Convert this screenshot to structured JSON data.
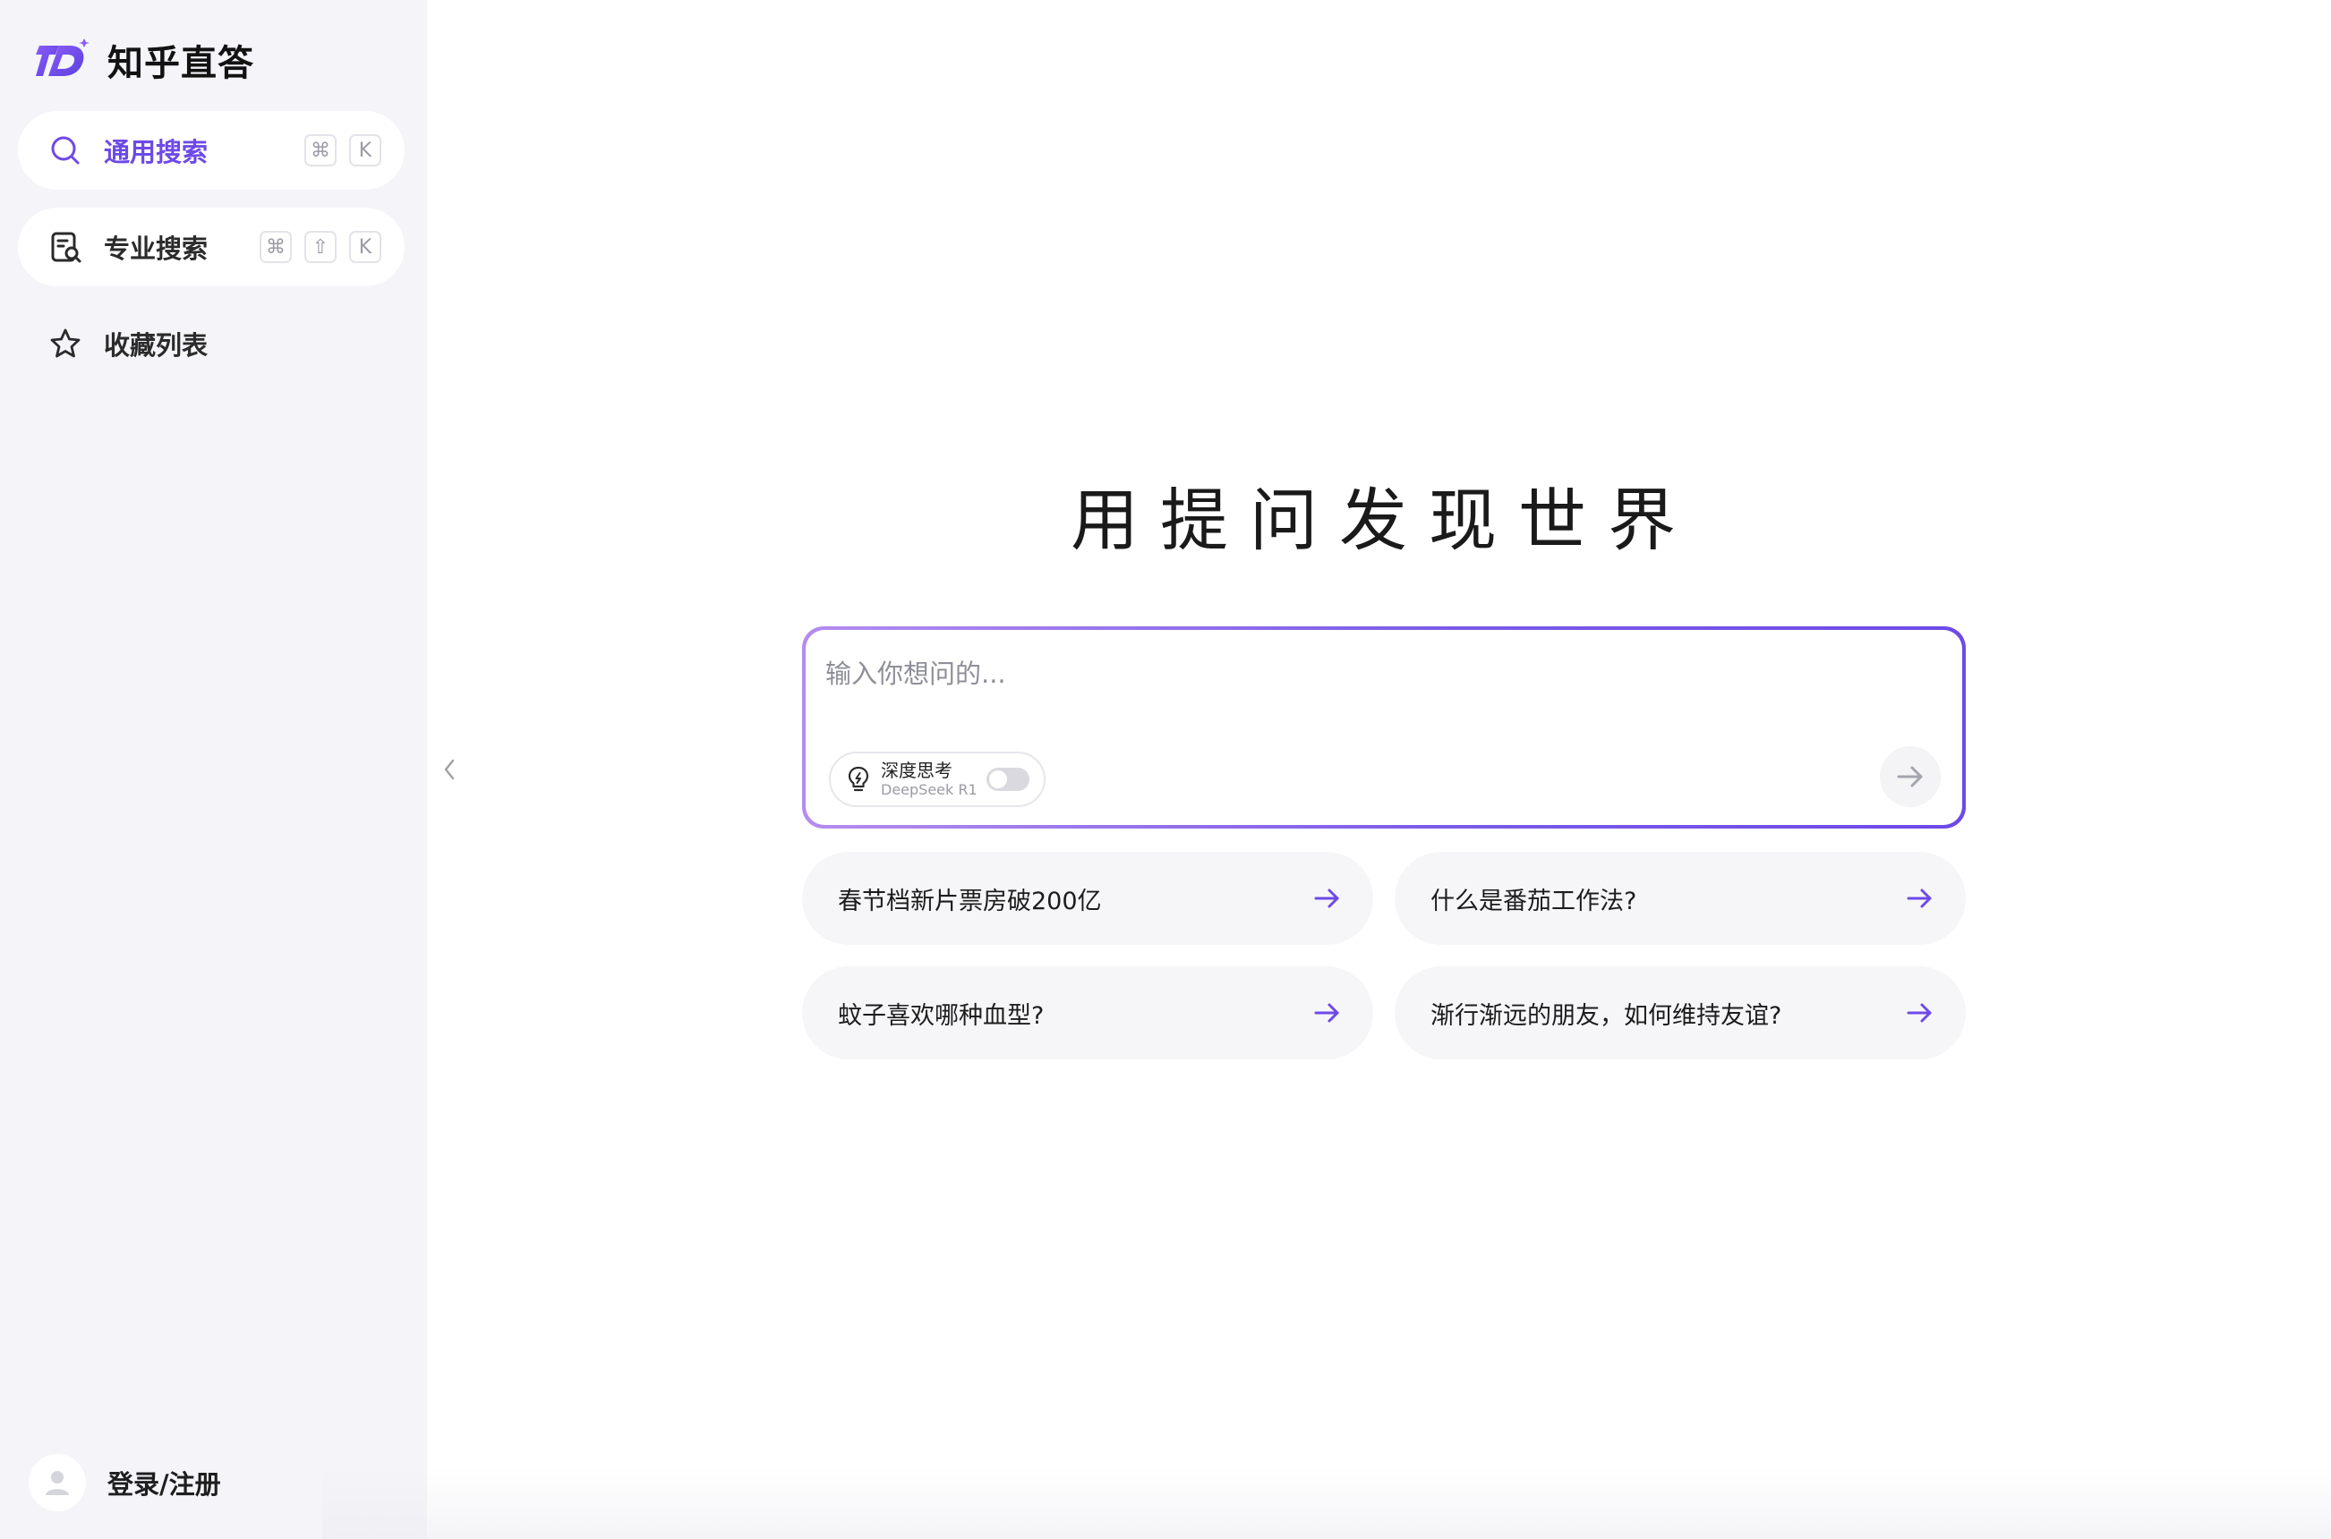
{
  "brand": {
    "name": "知乎直答",
    "logo_icon": "zhida-logo-icon",
    "accent": "#6d4ae8"
  },
  "sidebar": {
    "items": [
      {
        "label": "通用搜索",
        "icon": "search-icon",
        "shortcut": [
          "⌘",
          "K"
        ],
        "active": true
      },
      {
        "label": "专业搜索",
        "icon": "doc-search-icon",
        "shortcut": [
          "⌘",
          "⇧",
          "K"
        ],
        "active": false
      },
      {
        "label": "收藏列表",
        "icon": "star-icon",
        "active": false
      }
    ],
    "user": {
      "label": "登录/注册",
      "icon": "user-avatar-icon"
    }
  },
  "main": {
    "title": "用提问发现世界",
    "composer": {
      "placeholder": "输入你想问的...",
      "deep_think": {
        "label": "深度思考",
        "sublabel": "DeepSeek R1",
        "enabled": false
      },
      "send_icon": "arrow-right-icon"
    },
    "suggestions": [
      {
        "text": "春节档新片票房破200亿"
      },
      {
        "text": "什么是番茄工作法?"
      },
      {
        "text": "蚊子喜欢哪种血型?"
      },
      {
        "text": "渐行渐远的朋友，如何维持友谊?"
      }
    ]
  }
}
